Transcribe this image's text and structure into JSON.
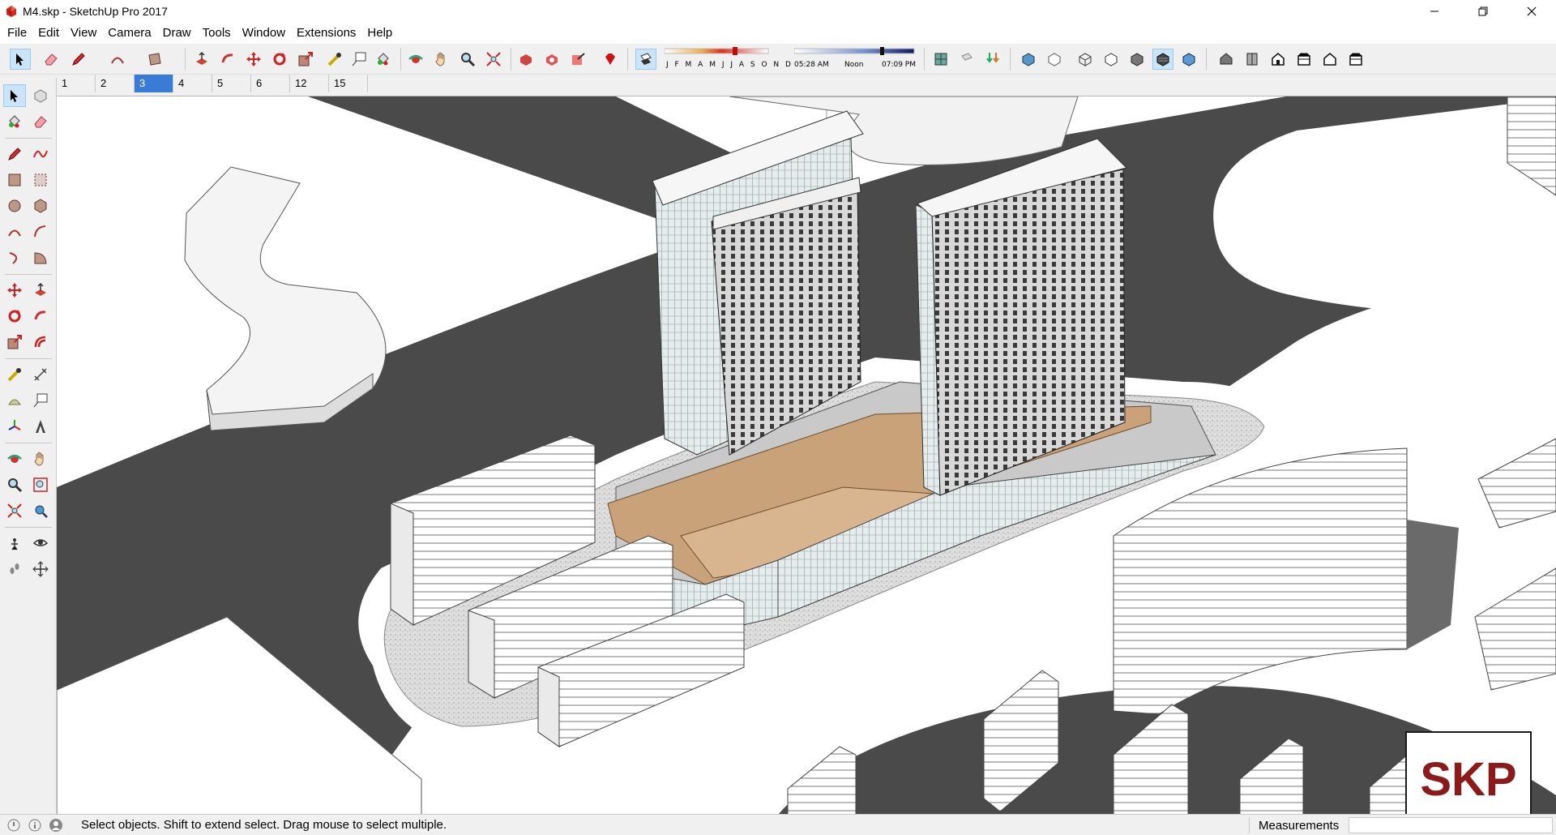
{
  "window": {
    "title": "M4.skp - SketchUp Pro 2017",
    "app_icon": "sketchup-icon",
    "controls": [
      "minimize-icon",
      "restore-icon",
      "close-icon"
    ]
  },
  "menu": [
    "File",
    "Edit",
    "View",
    "Camera",
    "Draw",
    "Tools",
    "Window",
    "Extensions",
    "Help"
  ],
  "shadow_settings": {
    "months_label": "J F M A M J J A S O N D",
    "time_start": "05:28 AM",
    "time_noon": "Noon",
    "time_end": "07:09 PM"
  },
  "scenes": {
    "tabs": [
      "1",
      "2",
      "3",
      "4",
      "5",
      "6",
      "12",
      "15"
    ],
    "active": "3"
  },
  "status": {
    "hint": "Select objects. Shift to extend select. Drag mouse to select multiple.",
    "measurements_label": "Measurements",
    "measurements_value": ""
  },
  "watermark": {
    "text": "SKP",
    "color": "#8b1a1a"
  },
  "colors": {
    "road": "#4a4a4a",
    "plaza": "#c9a27a",
    "ground": "#ffffff",
    "accent_selection": "#3a7bd5"
  }
}
